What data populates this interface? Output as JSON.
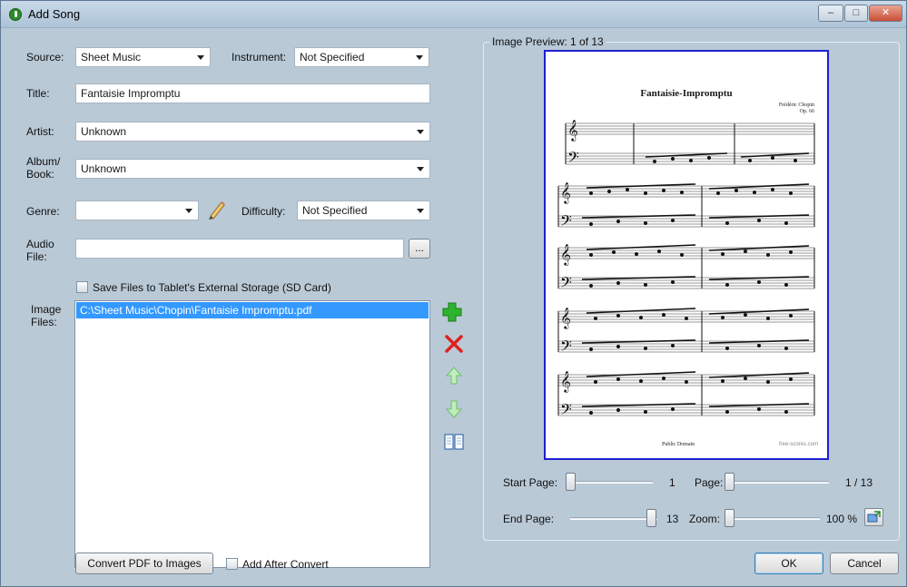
{
  "window": {
    "title": "Add Song",
    "min_glyph": "–",
    "max_glyph": "□",
    "close_glyph": "✕"
  },
  "form": {
    "source_label": "Source:",
    "source_value": "Sheet Music",
    "instrument_label": "Instrument:",
    "instrument_value": "Not Specified",
    "title_label": "Title:",
    "title_value": "Fantaisie Impromptu",
    "artist_label": "Artist:",
    "artist_value": "Unknown",
    "album_label_1": "Album/",
    "album_label_2": "Book:",
    "album_value": "Unknown",
    "genre_label": "Genre:",
    "genre_value": "",
    "difficulty_label": "Difficulty:",
    "difficulty_value": "Not Specified",
    "audio_label_1": "Audio",
    "audio_label_2": "File:",
    "audio_value": "",
    "browse_label": "...",
    "save_sd_label": "Save Files  to Tablet's External Storage (SD Card)",
    "image_files_label_1": "Image",
    "image_files_label_2": "Files:",
    "files": [
      "C:\\Sheet Music\\Chopin\\Fantaisie Impromptu.pdf"
    ],
    "convert_label": "Convert PDF to Images",
    "add_after_label": "Add After Convert"
  },
  "preview": {
    "legend": "Image Preview:  1 of 13",
    "score_title": "Fantaisie-Impromptu",
    "composer": "Frédéric Chopin",
    "opus": "Op. 66",
    "footer_left": "Public Domain",
    "footer_right": "free-scores.com",
    "start_page_label": "Start Page:",
    "start_page_value": "1",
    "page_label": "Page:",
    "page_value": "1 / 13",
    "end_page_label": "End Page:",
    "end_page_value": "13",
    "zoom_label": "Zoom:",
    "zoom_value": "100 %",
    "start_page_level": 0.0,
    "page_level": 0.0,
    "end_page_level": 1.0,
    "zoom_level": 0.0
  },
  "buttons": {
    "ok": "OK",
    "cancel": "Cancel"
  },
  "colors": {
    "accent_blue": "#3399ff",
    "preview_border": "#1f1fd1",
    "add_green": "#2db42d",
    "remove_red": "#e02020"
  },
  "icons": {
    "add": "plus-icon",
    "remove": "x-icon",
    "up": "arrow-up-icon",
    "down": "arrow-down-icon",
    "view": "book-icon",
    "edit": "pencil-icon",
    "zoom_fit": "fit-icon"
  }
}
